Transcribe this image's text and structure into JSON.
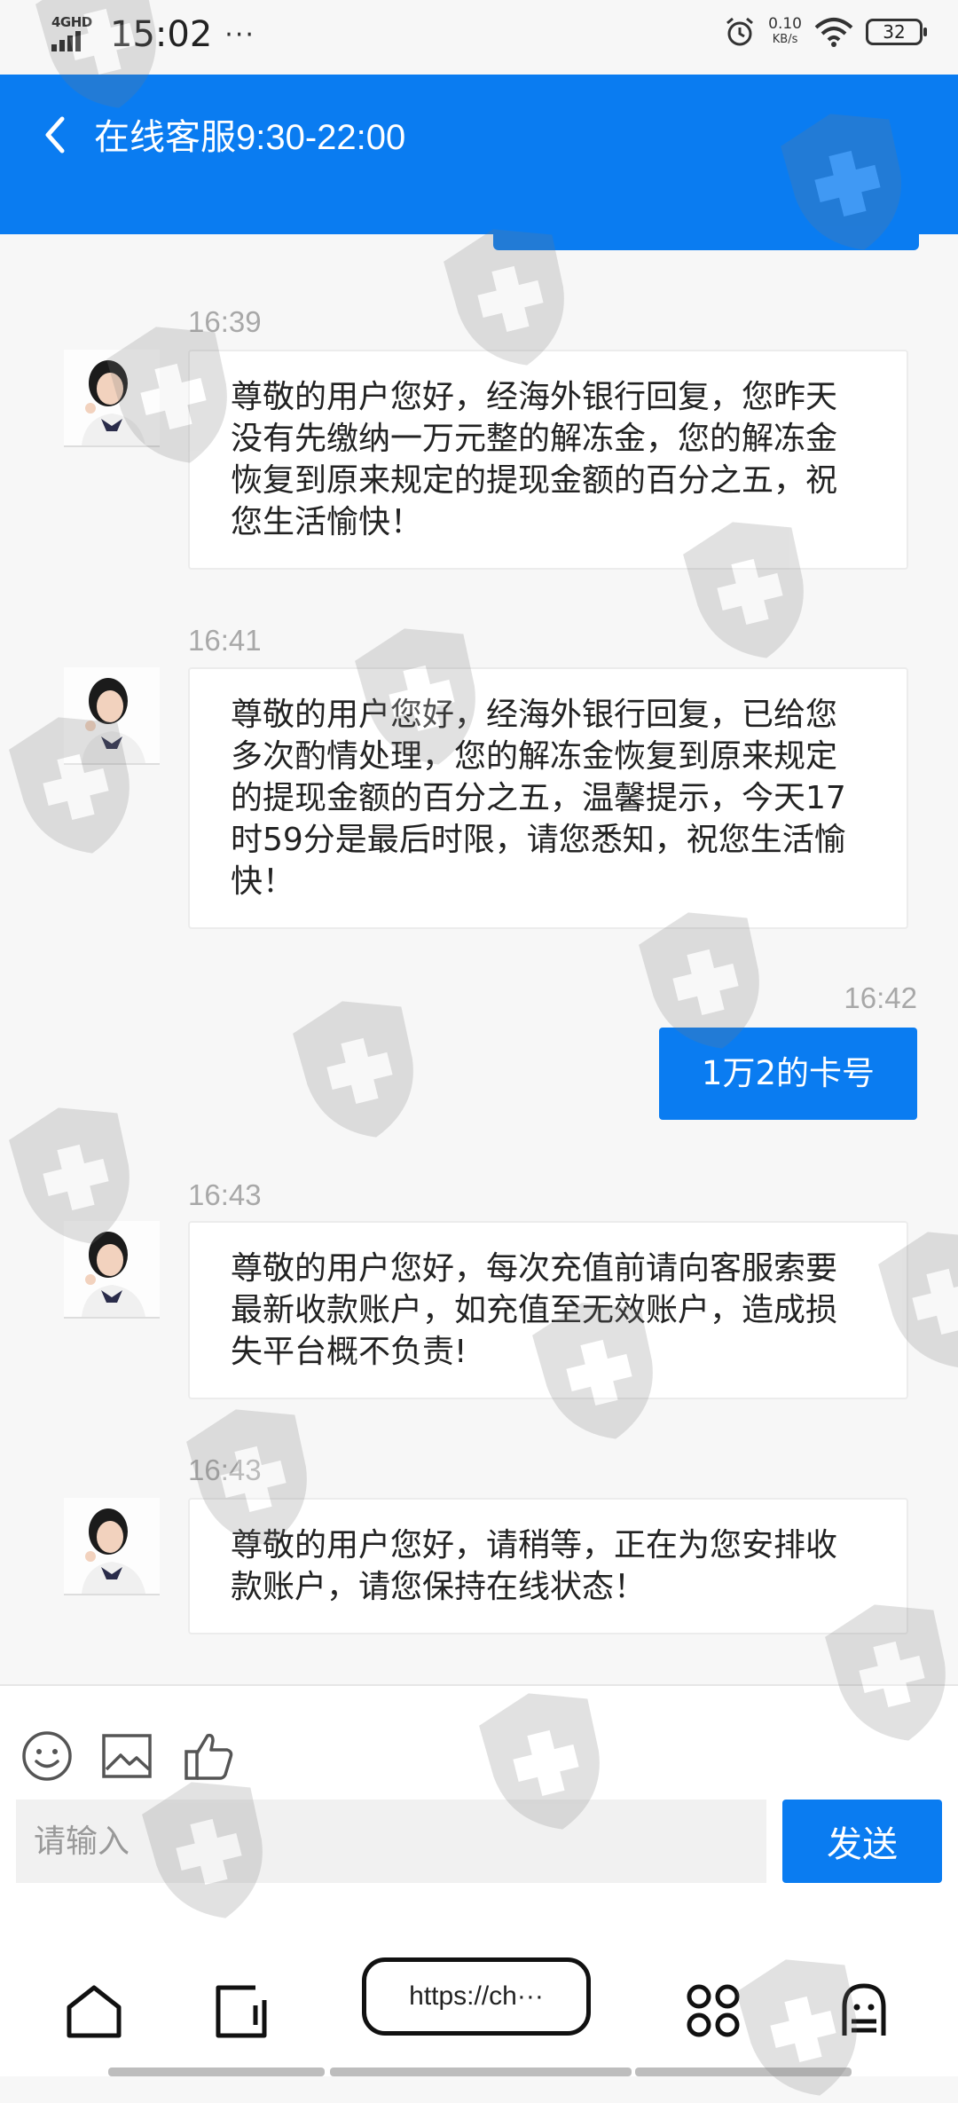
{
  "status_bar": {
    "network": "4GHD",
    "time": "15:02",
    "dots": "···",
    "speed_value": "0.10",
    "speed_unit": "KB/s",
    "battery": "32"
  },
  "header": {
    "title": "在线客服9:30-22:00"
  },
  "messages": [
    {
      "time": "16:39",
      "from": "agent",
      "text": "尊敬的用户您好，经海外银行回复，您昨天没有先缴纳一万元整的解冻金，您的解冻金恢复到原来规定的提现金额的百分之五，祝您生活愉快！"
    },
    {
      "time": "16:41",
      "from": "agent",
      "text": "尊敬的用户您好，经海外银行回复，已给您多次酌情处理，您的解冻金恢复到原来规定的提现金额的百分之五，温馨提示，今天17时59分是最后时限，请您悉知，祝您生活愉快！"
    },
    {
      "time": "16:42",
      "from": "user",
      "text": "1万2的卡号"
    },
    {
      "time": "16:43",
      "from": "agent",
      "text": "尊敬的用户您好，每次充值前请向客服索要最新收款账户，如充值至无效账户，造成损失平台概不负责!"
    },
    {
      "time": "16:43",
      "from": "agent",
      "text": "尊敬的用户您好，请稍等，正在为您安排收款账户，请您保持在线状态！"
    }
  ],
  "composer": {
    "placeholder": "请输入",
    "send_label": "发送",
    "tools": [
      "emoji-icon",
      "image-icon",
      "thumbs-up-icon"
    ]
  },
  "browser_bar": {
    "url": "https://ch···",
    "icons": [
      "home-icon",
      "tab-icon",
      "apps-icon",
      "ghost-icon"
    ]
  },
  "colors": {
    "accent": "#0a7cf1",
    "background": "#f7f7f7",
    "timestamp": "#a8a8a8"
  }
}
